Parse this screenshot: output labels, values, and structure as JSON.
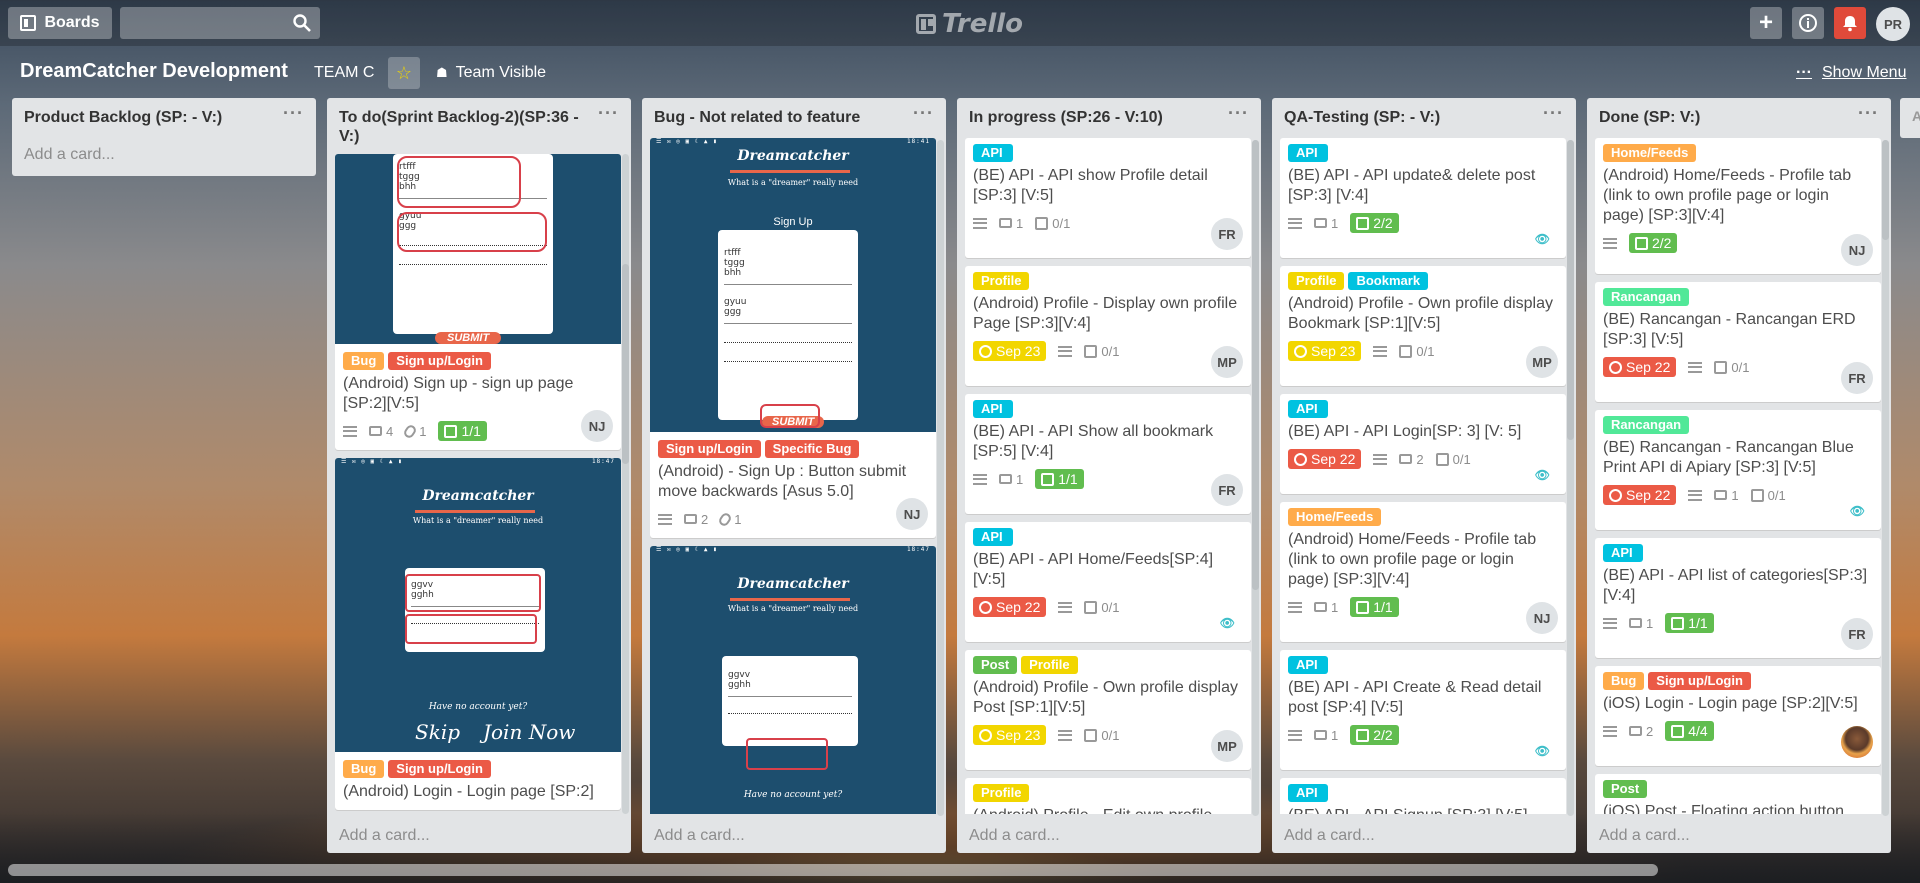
{
  "topbar": {
    "boards_label": "Boards",
    "logo_text": "Trello",
    "user_initials": "PR"
  },
  "board": {
    "title": "DreamCatcher Development",
    "team": "TEAM C",
    "visibility": "Team Visible",
    "show_menu": "Show Menu"
  },
  "label_colors": {
    "API": "#00c2e0",
    "Profile": "#f2d600",
    "Bookmark": "#00c2e0",
    "Bug": "#ffab4a",
    "Sign up/Login": "#eb5a46",
    "Specific Bug": "#eb5a46",
    "Home/Feeds": "#ffab4a",
    "Rancangan": "#51e898",
    "Post": "#61bd4f"
  },
  "due_colors": {
    "yellow": "#f2d600",
    "red": "#eb5a46"
  },
  "add_card_label": "Add a card...",
  "lists": [
    {
      "title": "Product Backlog (SP: - V:)"
    },
    {
      "title": "To do(Sprint Backlog-2)(SP:36 - V:)",
      "cards": [
        {
          "labels": [
            "Bug",
            "Sign up/Login"
          ],
          "title": "(Android) Sign up - sign up page [SP:2][V:5]",
          "comments": "4",
          "attachments": "1",
          "checklist": "1/1",
          "member": "NJ",
          "cover": {
            "lines": [
              "rtfff",
              "tggg",
              "bhh",
              "gyuu",
              "ggg"
            ],
            "submit": "SUBMIT"
          }
        },
        {
          "labels": [
            "Bug",
            "Sign up/Login"
          ],
          "title": "(Android) Login - Login page [SP:2]",
          "cover": {
            "status": "18:47",
            "app_title": "Dreamcatcher",
            "tagline": "What is a \"dreamer\" really need",
            "lines": [
              "ggvv",
              "gghh"
            ],
            "footer": "Have no account yet?",
            "skip": "Skip",
            "join": "Join Now"
          }
        }
      ]
    },
    {
      "title": "Bug - Not related to feature",
      "cards": [
        {
          "labels": [
            "Sign up/Login",
            "Specific Bug"
          ],
          "title": "(Android) - Sign Up : Button submit move backwards [Asus 5.0]",
          "comments": "2",
          "attachments": "1",
          "member": "NJ",
          "cover": {
            "status": "18:41",
            "app_title": "Dreamcatcher",
            "tagline": "What is a \"dreamer\" really need",
            "heading": "Sign Up",
            "lines": [
              "rtfff",
              "tggg",
              "bhh",
              "gyuu",
              "ggg"
            ],
            "submit": "SUBMIT"
          }
        },
        {
          "cover": {
            "status": "18:47",
            "app_title": "Dreamcatcher",
            "tagline": "What is a \"dreamer\" really need",
            "lines": [
              "ggvv",
              "gghh"
            ],
            "footer": "Have no account yet?"
          }
        }
      ]
    },
    {
      "title": "In progress (SP:26 - V:10)",
      "cards": [
        {
          "labels": [
            "API"
          ],
          "title": "(BE) API - API show Profile detail [SP:3] [V:5]",
          "comments": "1",
          "checklist": "0/1",
          "member": "FR"
        },
        {
          "labels": [
            "Profile"
          ],
          "title": "(Android) Profile - Display own profile Page [SP:3][V:4]",
          "due": "Sep 23",
          "due_color": "yellow",
          "checklist": "0/1",
          "member": "MP"
        },
        {
          "labels": [
            "API"
          ],
          "title": "(BE) API - API Show all bookmark [SP:5] [V:4]",
          "comments": "1",
          "checklist_done": "1/1",
          "member": "FR"
        },
        {
          "labels": [
            "API"
          ],
          "title": "(BE) API - API Home/Feeds[SP:4] [V:5]",
          "due": "Sep 22",
          "due_color": "red",
          "checklist": "0/1",
          "watch": true
        },
        {
          "labels": [
            "Post",
            "Profile"
          ],
          "title": "(Android) Profile - Own profile display Post [SP:1][V:5]",
          "due": "Sep 23",
          "due_color": "yellow",
          "checklist": "0/1",
          "member": "MP"
        },
        {
          "labels": [
            "Profile"
          ],
          "title": "(Android) Profile - Edit own profile"
        }
      ]
    },
    {
      "title": "QA-Testing (SP: - V:)",
      "cards": [
        {
          "labels": [
            "API"
          ],
          "title": "(BE) API - API update& delete post [SP:3] [V:4]",
          "comments": "1",
          "checklist_done": "2/2",
          "watch": true
        },
        {
          "labels": [
            "Profile",
            "Bookmark"
          ],
          "title": "(Android) Profile - Own profile display Bookmark [SP:1][V:5]",
          "due": "Sep 23",
          "due_color": "yellow",
          "checklist": "0/1",
          "member": "MP"
        },
        {
          "labels": [
            "API"
          ],
          "title": "(BE) API - API Login[SP: 3] [V: 5]",
          "due": "Sep 22",
          "due_color": "red",
          "comments": "2",
          "checklist": "0/1",
          "watch": true
        },
        {
          "labels": [
            "Home/Feeds"
          ],
          "title": "(Android) Home/Feeds - Profile tab (link to own profile page or login page) [SP:3][V:4]",
          "comments": "1",
          "checklist_done": "1/1",
          "member": "NJ"
        },
        {
          "labels": [
            "API"
          ],
          "title": "(BE) API - API Create & Read detail post [SP:4] [V:5]",
          "comments": "1",
          "checklist_done": "2/2",
          "watch": true
        },
        {
          "labels": [
            "API"
          ],
          "title": "(BE) API - API Signup [SP:3] [V:5]"
        }
      ]
    },
    {
      "title": "Done (SP: V:)",
      "cards": [
        {
          "labels": [
            "Home/Feeds"
          ],
          "title": "(Android) Home/Feeds - Profile tab (link to own profile page or login page) [SP:3][V:4]",
          "checklist_done": "2/2",
          "member": "NJ"
        },
        {
          "labels": [
            "Rancangan"
          ],
          "title": "(BE) Rancangan - Rancangan ERD [SP:3] [V:5]",
          "due": "Sep 22",
          "due_color": "red",
          "checklist": "0/1",
          "member": "FR"
        },
        {
          "labels": [
            "Rancangan"
          ],
          "title": "(BE) Rancangan - Rancangan Blue Print API di Apiary [SP:3] [V:5]",
          "due": "Sep 22",
          "due_color": "red",
          "comments": "1",
          "checklist": "0/1",
          "watch": true
        },
        {
          "labels": [
            "API"
          ],
          "title": "(BE) API - API list of categories[SP:3] [V:4]",
          "comments": "1",
          "checklist_done": "1/1",
          "member": "FR"
        },
        {
          "labels": [
            "Bug",
            "Sign up/Login"
          ],
          "title": "(iOS) Login - Login page [SP:2][V:5]",
          "comments": "2",
          "checklist_done": "4/4",
          "member_photo": true
        },
        {
          "labels": [
            "Post"
          ],
          "title": "(iOS) Post - Floating action button"
        }
      ]
    }
  ],
  "peek_list_initial": "A"
}
